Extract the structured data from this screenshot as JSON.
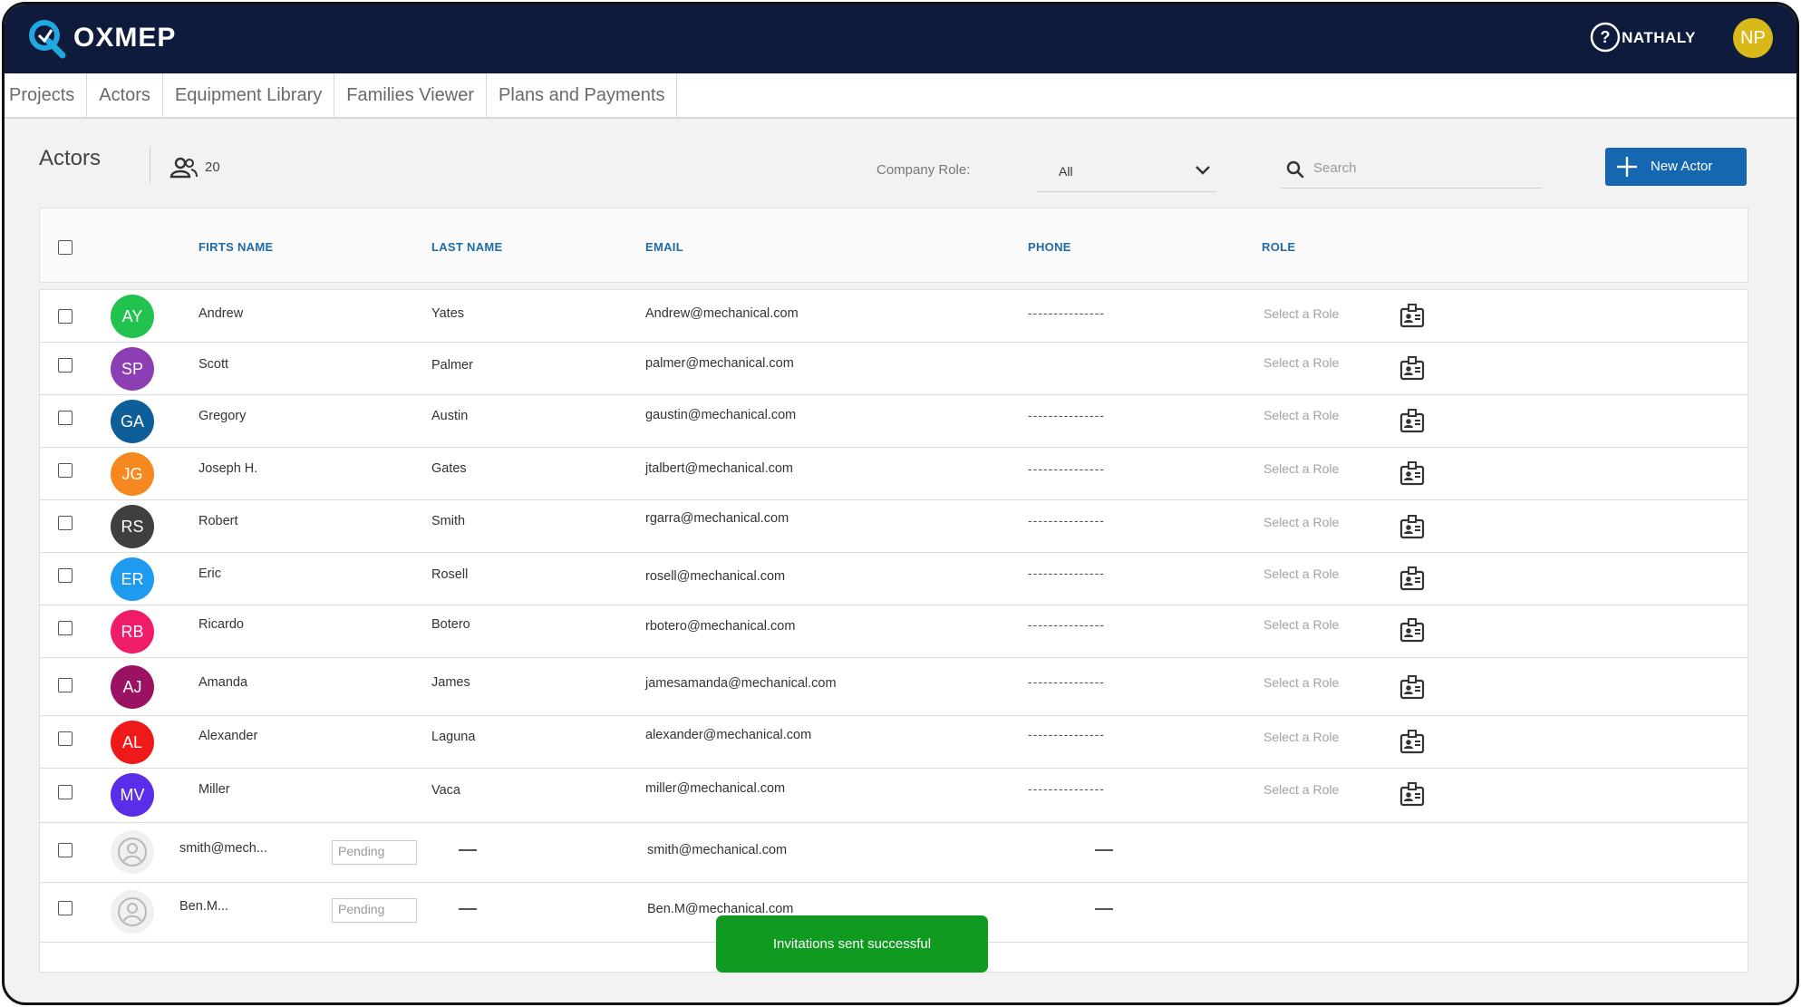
{
  "app": {
    "brand": "OXMEP"
  },
  "header": {
    "user_name": "NATHALY",
    "user_initials": "NP"
  },
  "nav": {
    "tabs": [
      "Projects",
      "Actors",
      "Equipment Library",
      "Families Viewer",
      "Plans and Payments"
    ]
  },
  "toolbar": {
    "title": "Actors",
    "count": "20",
    "company_role_label": "Company Role:",
    "company_role_value": "All",
    "search_placeholder": "Search",
    "new_actor_label": "New Actor"
  },
  "table": {
    "columns": [
      "FIRTS NAME",
      "LAST NAME",
      "EMAIL",
      "PHONE",
      "ROLE"
    ],
    "rows": [
      {
        "initials": "AY",
        "color": "#22c24f",
        "first": "Andrew",
        "last": "Yates",
        "email": "Andrew@mechanical.com",
        "phone": "---------------",
        "role": "Select a Role"
      },
      {
        "initials": "SP",
        "color": "#8b3fb3",
        "first": "Scott",
        "last": "Palmer",
        "email": "palmer@mechanical.com",
        "phone": "",
        "role": "Select a Role"
      },
      {
        "initials": "GA",
        "color": "#0e5f99",
        "first": "Gregory",
        "last": "Austin",
        "email": "gaustin@mechanical.com",
        "phone": "---------------",
        "role": "Select a Role"
      },
      {
        "initials": "JG",
        "color": "#f5891f",
        "first": "Joseph H.",
        "last": "Gates",
        "email": "jtalbert@mechanical.com",
        "phone": "---------------",
        "role": "Select a Role"
      },
      {
        "initials": "RS",
        "color": "#3f3f3f",
        "first": "Robert",
        "last": "Smith",
        "email": "rgarra@mechanical.com",
        "phone": "---------------",
        "role": "Select a Role"
      },
      {
        "initials": "ER",
        "color": "#1e9bef",
        "first": "Eric",
        "last": "Rosell",
        "email": "rosell@mechanical.com",
        "phone": "---------------",
        "role": "Select a Role"
      },
      {
        "initials": "RB",
        "color": "#ef1c6a",
        "first": "Ricardo",
        "last": "Botero",
        "email": "rbotero@mechanical.com",
        "phone": "---------------",
        "role": "Select a Role"
      },
      {
        "initials": "AJ",
        "color": "#9b1263",
        "first": "Amanda",
        "last": "James",
        "email": "jamesamanda@mechanical.com",
        "phone": "---------------",
        "role": "Select a Role"
      },
      {
        "initials": "AL",
        "color": "#ee1a1a",
        "first": "Alexander",
        "last": "Laguna",
        "email": "alexander@mechanical.com",
        "phone": "---------------",
        "role": "Select a Role"
      },
      {
        "initials": "MV",
        "color": "#5a2ee8",
        "first": "Miller",
        "last": "Vaca",
        "email": "miller@mechanical.com",
        "phone": "---------------",
        "role": "Select a Role"
      }
    ],
    "pending_rows": [
      {
        "name": "smith@mech...",
        "status": "Pending",
        "email": "smith@mechanical.com"
      },
      {
        "name": "Ben.M...",
        "status": "Pending",
        "email": "Ben.M@mechanical.com"
      }
    ]
  },
  "toast": {
    "message": "Invitations sent successful"
  }
}
